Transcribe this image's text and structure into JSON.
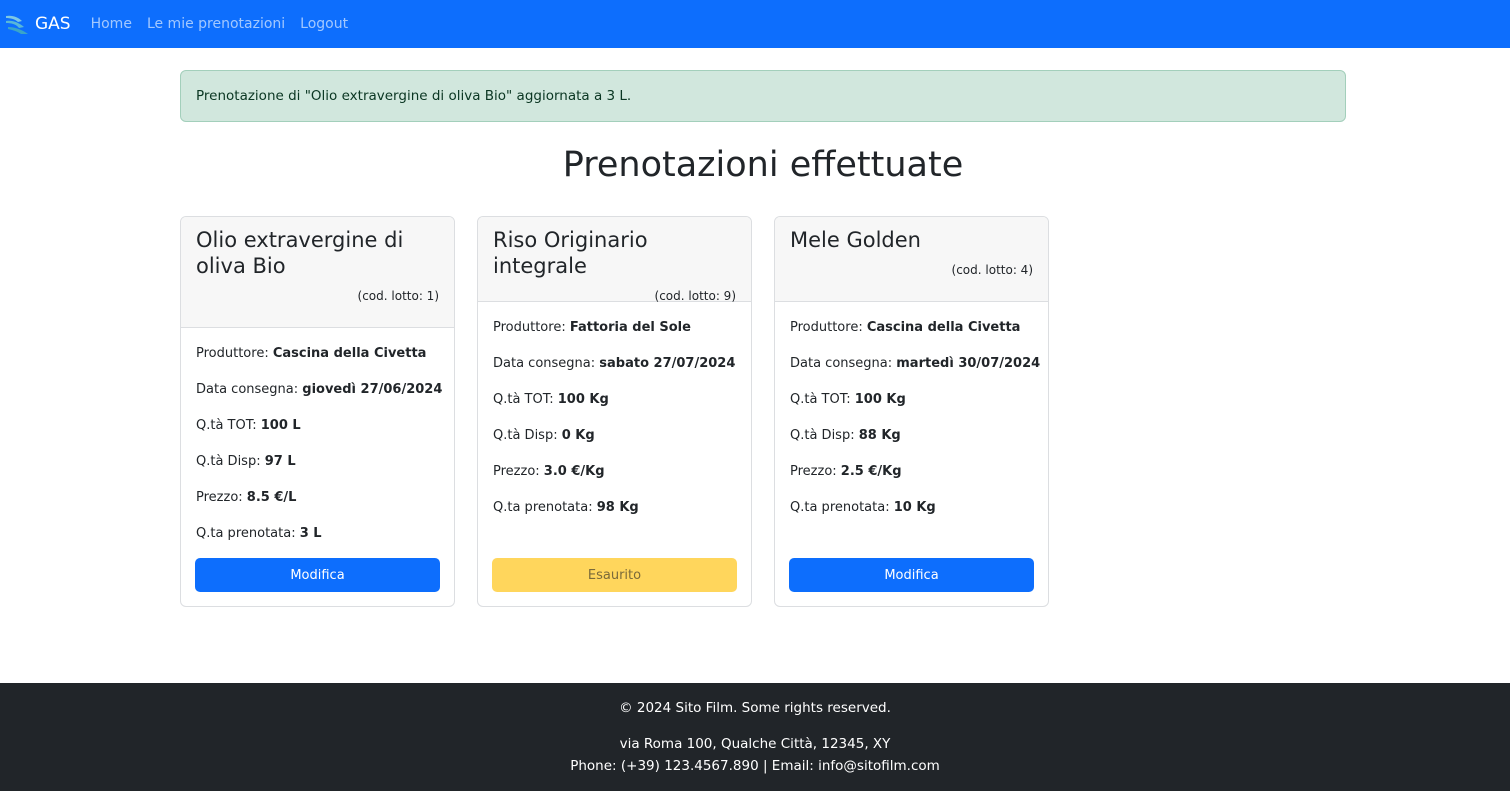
{
  "navbar": {
    "brand": "GAS",
    "links": [
      "Home",
      "Le mie prenotazioni",
      "Logout"
    ]
  },
  "alert": {
    "message": "Prenotazione di \"Olio extravergine di oliva Bio\" aggiornata a 3 L."
  },
  "page": {
    "title": "Prenotazioni effettuate"
  },
  "cards": [
    {
      "title": "Olio extravergine di oliva Bio",
      "lotto": "(cod. lotto: 1)",
      "fields": [
        {
          "label": "Produttore: ",
          "value": "Cascina della Civetta"
        },
        {
          "label": "Data consegna: ",
          "value": "giovedì 27/06/2024"
        },
        {
          "label": "Q.tà TOT: ",
          "value": "100 L"
        },
        {
          "label": "Q.tà Disp: ",
          "value": "97 L"
        },
        {
          "label": "Prezzo: ",
          "value": "8.5 €/L"
        },
        {
          "label": "Q.ta prenotata: ",
          "value": "3 L"
        }
      ],
      "button": "Modifica"
    },
    {
      "title": "Riso Originario integrale",
      "lotto": "(cod. lotto: 9)",
      "fields": [
        {
          "label": "Produttore: ",
          "value": "Fattoria del Sole"
        },
        {
          "label": "Data consegna: ",
          "value": "sabato 27/07/2024"
        },
        {
          "label": "Q.tà TOT: ",
          "value": "100 Kg"
        },
        {
          "label": "Q.tà Disp: ",
          "value": "0 Kg"
        },
        {
          "label": "Prezzo: ",
          "value": "3.0 €/Kg"
        },
        {
          "label": "Q.ta prenotata: ",
          "value": "98 Kg"
        }
      ],
      "button": "Esaurito"
    },
    {
      "title": "Mele Golden",
      "lotto": "(cod. lotto: 4)",
      "fields": [
        {
          "label": "Produttore: ",
          "value": "Cascina della Civetta"
        },
        {
          "label": "Data consegna: ",
          "value": "martedì 30/07/2024"
        },
        {
          "label": "Q.tà TOT: ",
          "value": "100 Kg"
        },
        {
          "label": "Q.tà Disp: ",
          "value": "88 Kg"
        },
        {
          "label": "Prezzo: ",
          "value": "2.5 €/Kg"
        },
        {
          "label": "Q.ta prenotata: ",
          "value": "10 Kg"
        }
      ],
      "button": "Modifica"
    }
  ],
  "footer": {
    "copyright": "© 2024 Sito Film. Some rights reserved.",
    "address": "via Roma 100, Qualche Città, 12345, XY",
    "contact": "Phone: (+39) 123.4567.890 | Email: info@sitofilm.com"
  },
  "colors": {
    "primary": "#0d6efd",
    "warning": "#ffd65c",
    "alert_bg": "#d1e7dd",
    "footer_bg": "#212529"
  },
  "icons": [
    "gas-logo-icon"
  ]
}
